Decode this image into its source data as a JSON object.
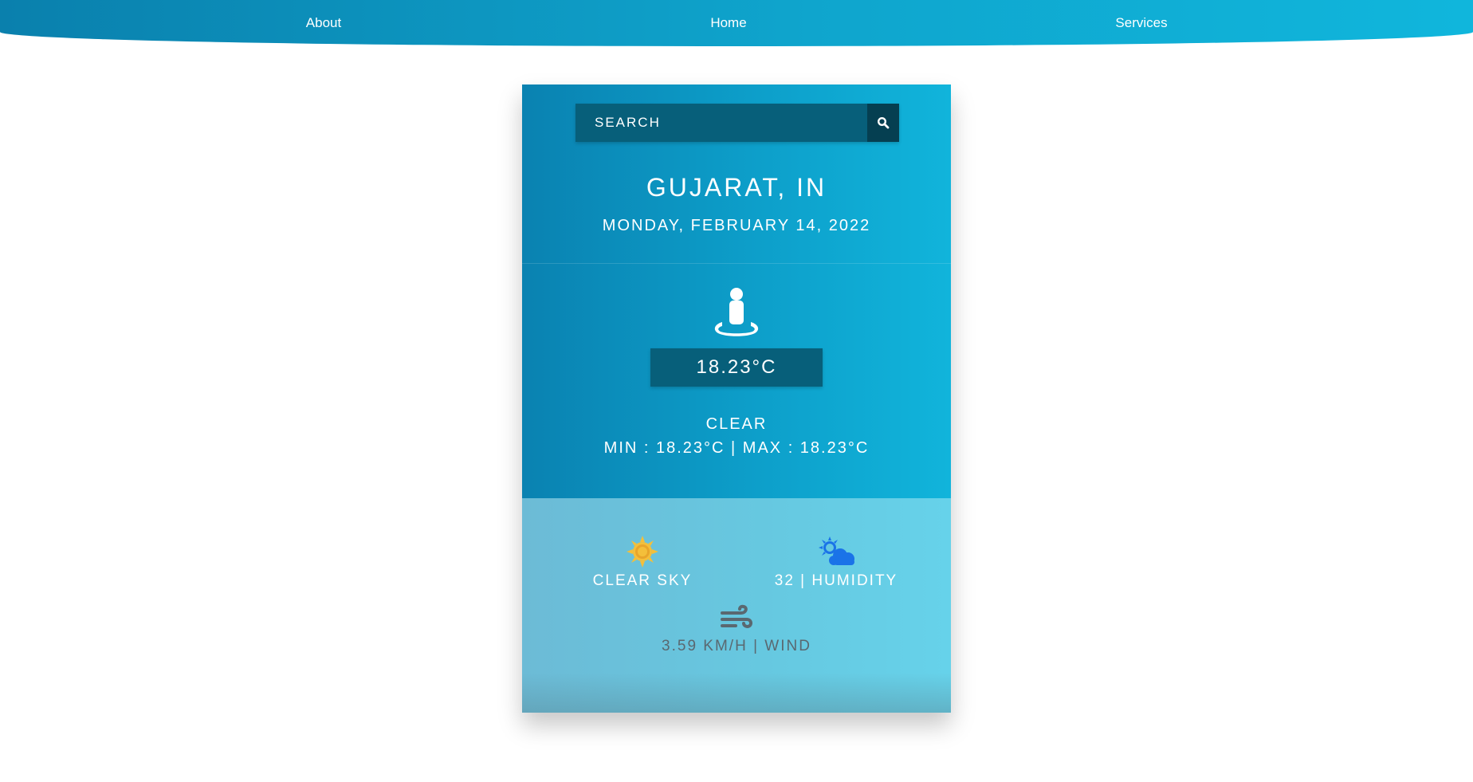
{
  "nav": {
    "items": [
      {
        "label": "About"
      },
      {
        "label": "Home"
      },
      {
        "label": "Services"
      }
    ]
  },
  "search": {
    "placeholder": "SEARCH",
    "icon": "search-icon"
  },
  "weather": {
    "location": "GUJARAT, IN",
    "date": "MONDAY, FEBRUARY 14, 2022",
    "main_icon": "person-location-icon",
    "temperature": "18.23°C",
    "condition": "CLEAR",
    "min_max": "MIN : 18.23°C | MAX : 18.23°C"
  },
  "details": {
    "sky": {
      "label": "CLEAR SKY",
      "icon": "sun-icon"
    },
    "humidity": {
      "label": "32 | HUMIDITY",
      "icon": "cloud-sun-icon"
    },
    "wind": {
      "label": "3.59 KM/H | WIND",
      "icon": "wind-icon"
    }
  },
  "colors": {
    "header_gradient_start": "#0a80ad",
    "header_gradient_end": "#10b6dc",
    "input_background": "#075f7a",
    "search_button_background": "#053f51",
    "detail_panel": "#66c9e1",
    "sun_icon": "#f4bf3a",
    "humidity_icon": "#1a73e8",
    "wind_icon": "#5a6870"
  }
}
